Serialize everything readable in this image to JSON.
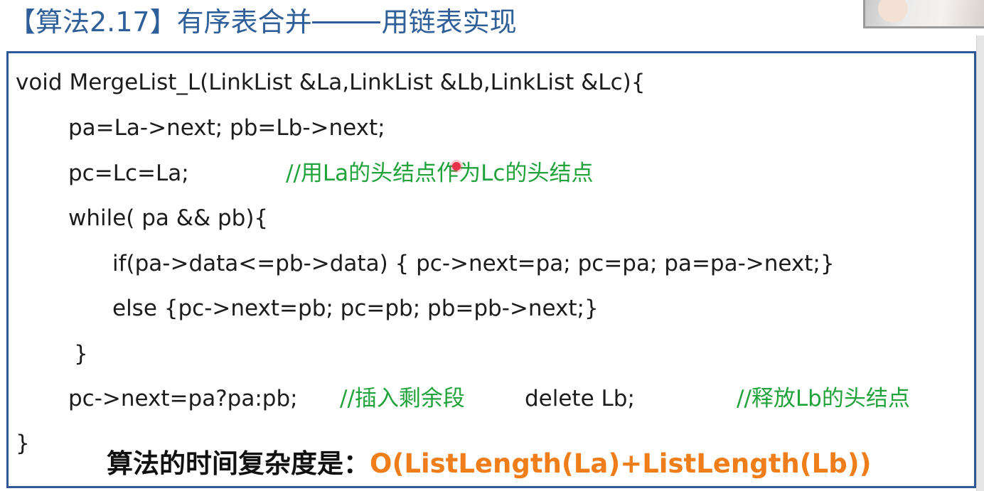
{
  "title": {
    "prefix": "【算法2.17】有序表合并",
    "suffix": "用链表实现"
  },
  "code": {
    "signature": "void MergeList_L(LinkList &La,LinkList &Lb,LinkList &Lc){",
    "line_init": "pa=La->next;  pb=Lb->next;",
    "line_pc": "pc=Lc=La;",
    "comment_pc": "//用La的头结点作为Lc的头结点",
    "line_while": "while( pa && pb){",
    "line_if": "if(pa->data<=pb->data) { pc->next=pa; pc=pa; pa=pa->next;}",
    "line_else": "else {pc->next=pb; pc=pb; pb=pb->next;}",
    "line_close_while": "}",
    "line_rest": "pc->next=pa?pa:pb;",
    "comment_rest": "//插入剩余段",
    "line_delete": "delete Lb;",
    "comment_delete": "//释放Lb的头结点",
    "line_close_fn": "}"
  },
  "complexity": {
    "label": "算法的时间复杂度是：",
    "expression": "O(ListLength(La)+ListLength(Lb))"
  },
  "colors": {
    "title": "#2e5f98",
    "border": "#2f5897",
    "code": "#1c1c1c",
    "comment": "#21a33b",
    "complexity_expr": "#ee7d1a",
    "cursor": "#e8314a"
  }
}
